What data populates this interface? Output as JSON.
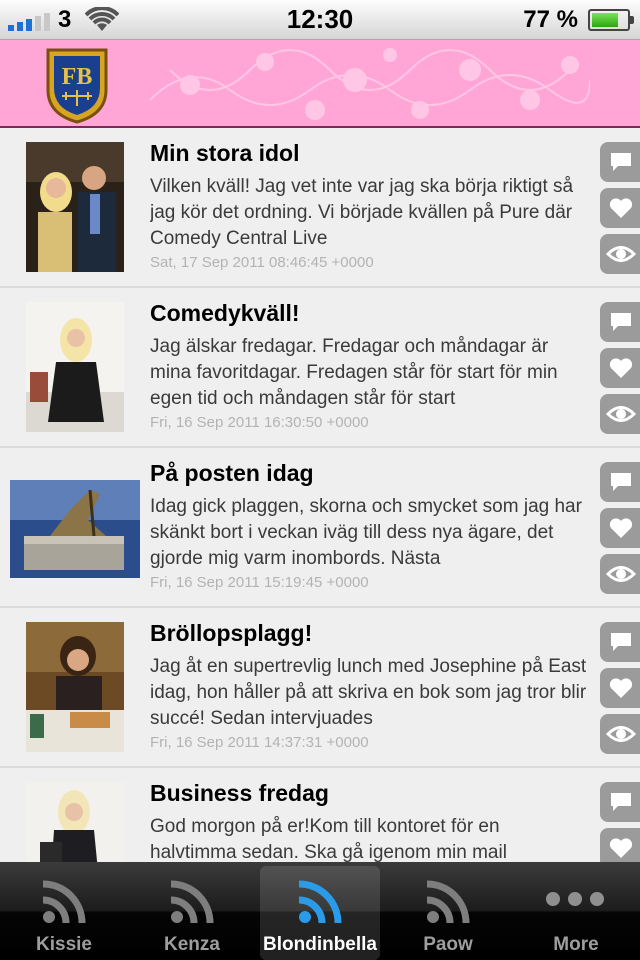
{
  "status_bar": {
    "carrier": "3",
    "time": "12:30",
    "battery": "77 %",
    "battery_level": 0.77,
    "signal_bars": 3
  },
  "header": {
    "logo_text": "FB",
    "background": "#ffa6d6"
  },
  "posts": [
    {
      "title": "Min stora idol",
      "excerpt": "Vilken kväll! Jag vet inte var jag ska börja riktigt så jag kör det ordning. Vi började kvällen på Pure där Comedy Central Live",
      "date": "Sat, 17 Sep 2011 08:46:45 +0000"
    },
    {
      "title": "Comedykväll!",
      "excerpt": "Jag älskar fredagar. Fredagar och måndagar är mina favoritdagar. Fredagen står för start för min egen tid och måndagen står för start",
      "date": "Fri, 16 Sep 2011 16:30:50 +0000"
    },
    {
      "title": "På posten idag",
      "excerpt": "Idag gick plaggen, skorna och smycket som jag har skänkt bort i veckan iväg till dess nya ägare, det gjorde mig varm inombords. Nästa",
      "date": "Fri, 16 Sep 2011 15:19:45 +0000"
    },
    {
      "title": "Bröllopsplagg!",
      "excerpt": "Jag åt en supertrevlig lunch med Josephine på East idag,  hon håller på att skriva en bok som jag tror blir succé! Sedan intervjuades",
      "date": "Fri, 16 Sep 2011 14:37:31 +0000"
    },
    {
      "title": "Business fredag",
      "excerpt": "God morgon på er!Kom till kontoret för en halvtimma sedan. Ska gå igenom min mail",
      "date": ""
    }
  ],
  "action_icons": [
    "comment-icon",
    "heart-icon",
    "eye-icon"
  ],
  "tabs": [
    {
      "label": "Kissie",
      "icon": "rss-icon",
      "active": false
    },
    {
      "label": "Kenza",
      "icon": "rss-icon",
      "active": false
    },
    {
      "label": "Blondinbella",
      "icon": "rss-icon",
      "active": true
    },
    {
      "label": "Paow",
      "icon": "rss-icon",
      "active": false
    },
    {
      "label": "More",
      "icon": "more-icon",
      "active": false
    }
  ],
  "colors": {
    "accent_blue": "#1f8fe0",
    "action_gray": "#9b9b9b"
  }
}
